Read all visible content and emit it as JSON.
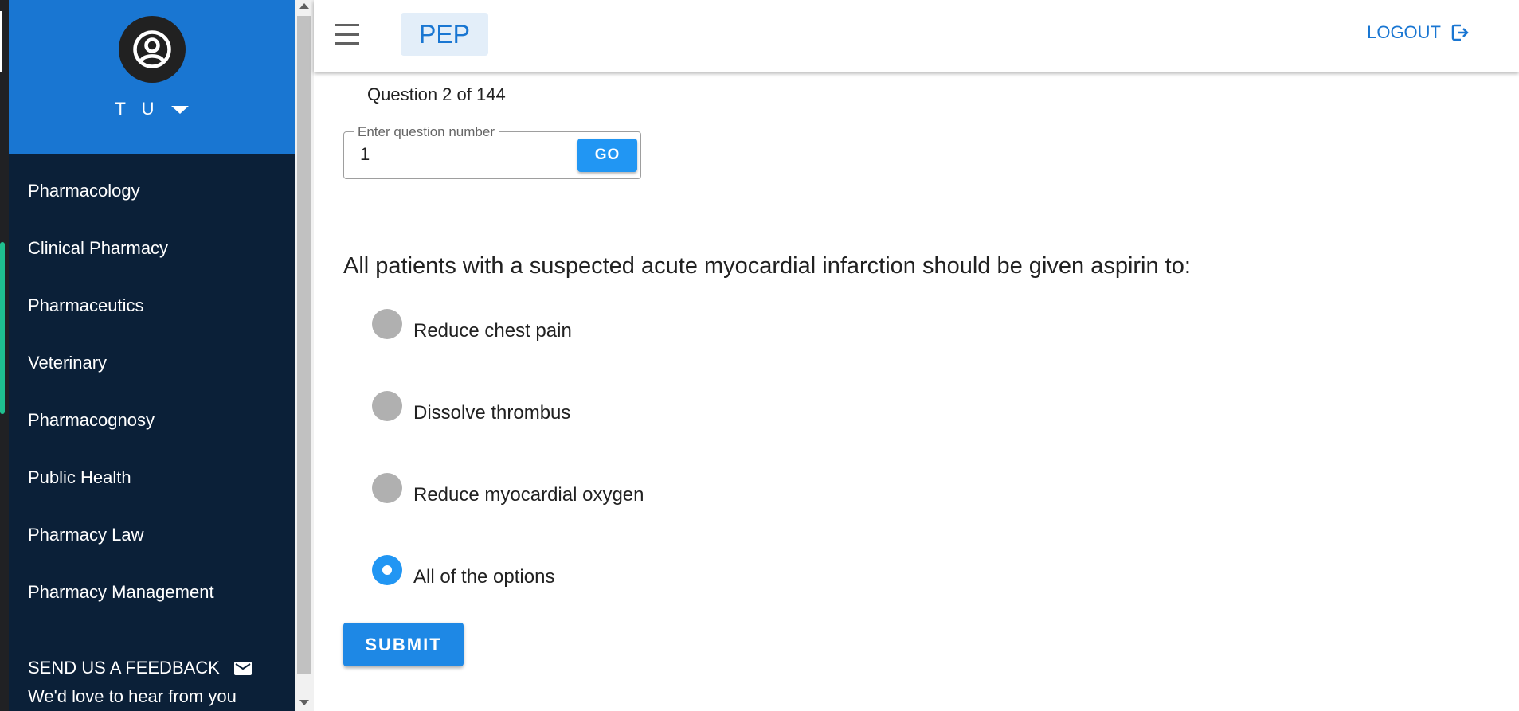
{
  "user": {
    "initials": "T U"
  },
  "nav": {
    "items": [
      {
        "label": "Pharmacology"
      },
      {
        "label": "Clinical Pharmacy"
      },
      {
        "label": "Pharmaceutics"
      },
      {
        "label": "Veterinary"
      },
      {
        "label": "Pharmacognosy"
      },
      {
        "label": "Public Health"
      },
      {
        "label": "Pharmacy Law"
      },
      {
        "label": "Pharmacy Management"
      }
    ]
  },
  "feedback": {
    "title": "SEND US A FEEDBACK",
    "subtitle": "We'd love to hear from you",
    "icon": "mail-icon"
  },
  "appbar": {
    "brand": "PEP",
    "logout_label": "LOGOUT",
    "menu_icon": "hamburger-menu-icon",
    "logout_icon": "logout-icon"
  },
  "quiz": {
    "counter": "Question 2 of 144",
    "jump": {
      "label": "Enter question number",
      "value": "1",
      "go_label": "GO"
    },
    "question": "All patients with a suspected acute myocardial infarction should be given aspirin to:",
    "options": [
      {
        "label": "Reduce chest pain",
        "selected": false
      },
      {
        "label": "Dissolve thrombus",
        "selected": false
      },
      {
        "label": "Reduce myocardial oxygen",
        "selected": false
      },
      {
        "label": "All of the options",
        "selected": true
      }
    ],
    "submit_label": "SUBMIT"
  },
  "colors": {
    "primary": "#1976d2",
    "sidebar": "#0b2038",
    "accent": "#2196f3"
  }
}
